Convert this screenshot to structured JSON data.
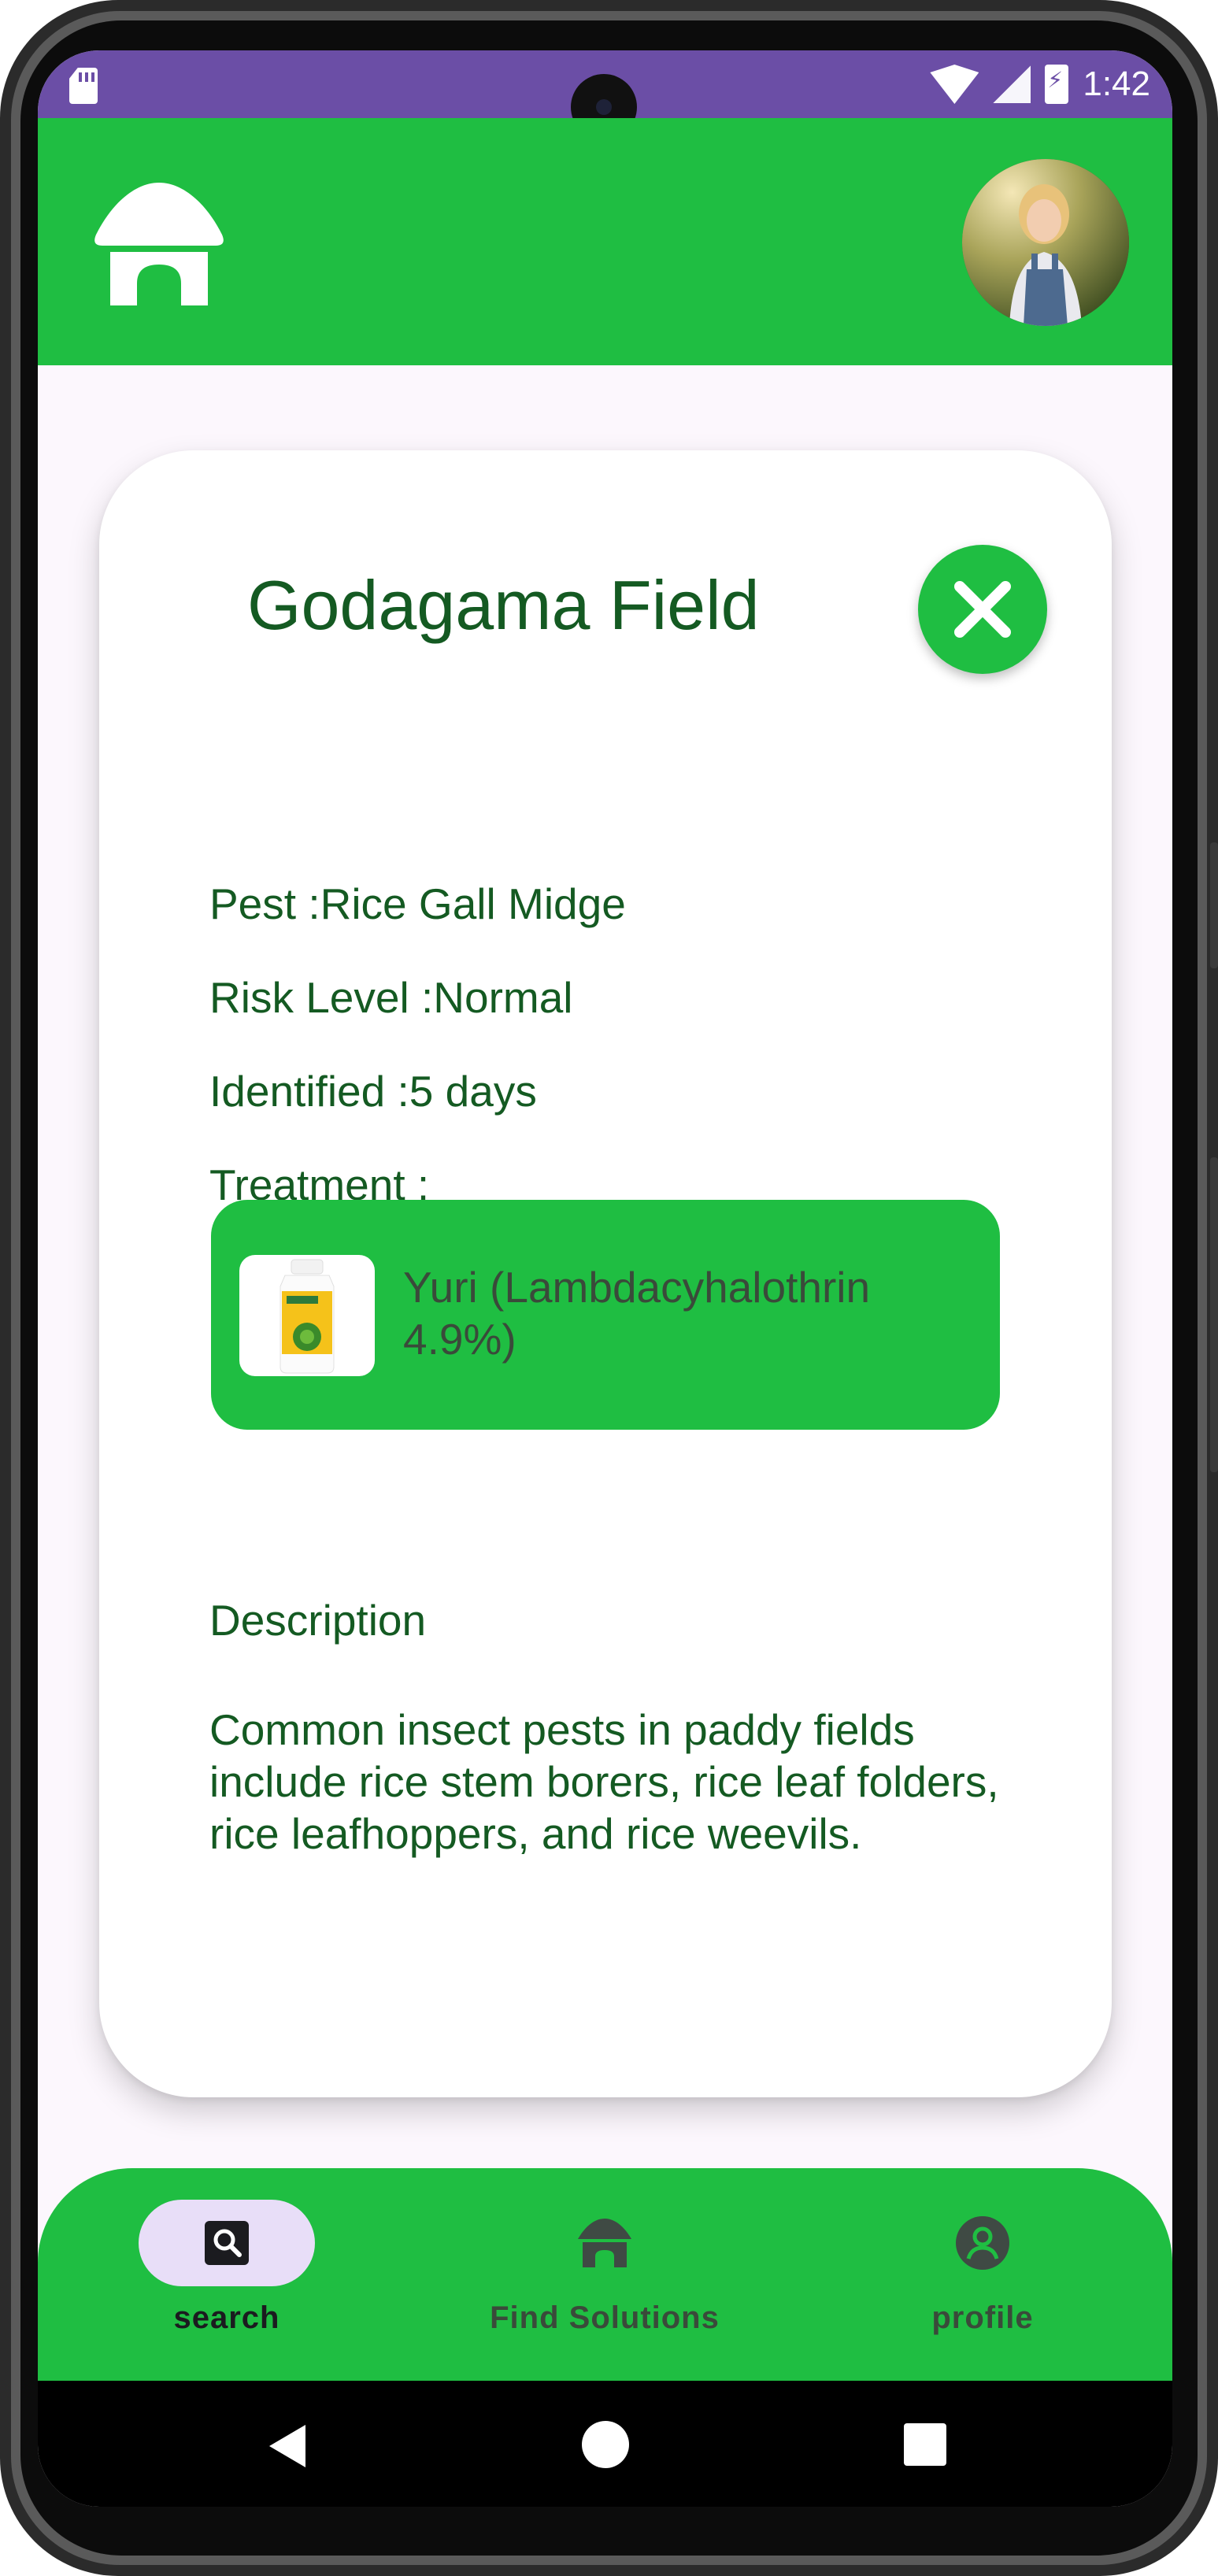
{
  "status_bar": {
    "time": "1:42",
    "sd_icon": "sd-card-icon",
    "wifi_icon": "wifi-icon",
    "signal_icon": "signal-icon",
    "battery_icon": "battery-charging-icon"
  },
  "app_bar": {
    "logo_icon": "house-icon",
    "avatar_icon": "user-avatar-photo"
  },
  "card": {
    "title": "Godagama Field",
    "close_icon": "close-icon",
    "pest": "Pest :Rice Gall Midge",
    "risk_level": "Risk Level :Normal",
    "identified": "Identified :5 days",
    "treatment_label": "Treatment :",
    "treatment": {
      "name": "Yuri (Lambdacyhalothrin 4.9%)",
      "image_icon": "pesticide-bottle-image"
    },
    "description_heading": "Description",
    "description": "Common insect pests in paddy fields include rice stem borers, rice leaf folders, rice leafhoppers, and rice weevils."
  },
  "bottom_nav": {
    "items": [
      {
        "label": "search",
        "icon": "search-icon",
        "active": true
      },
      {
        "label": "Find Solutions",
        "icon": "house-icon",
        "active": false
      },
      {
        "label": "profile",
        "icon": "profile-icon",
        "active": false
      }
    ]
  },
  "system_nav": {
    "back_icon": "back-icon",
    "home_icon": "home-circle-icon",
    "recents_icon": "recents-icon"
  },
  "colors": {
    "primary_green": "#1fbe42",
    "dark_green_text": "#145a22",
    "status_bar_purple": "#6b4ea6",
    "active_pill": "#e8def8"
  }
}
